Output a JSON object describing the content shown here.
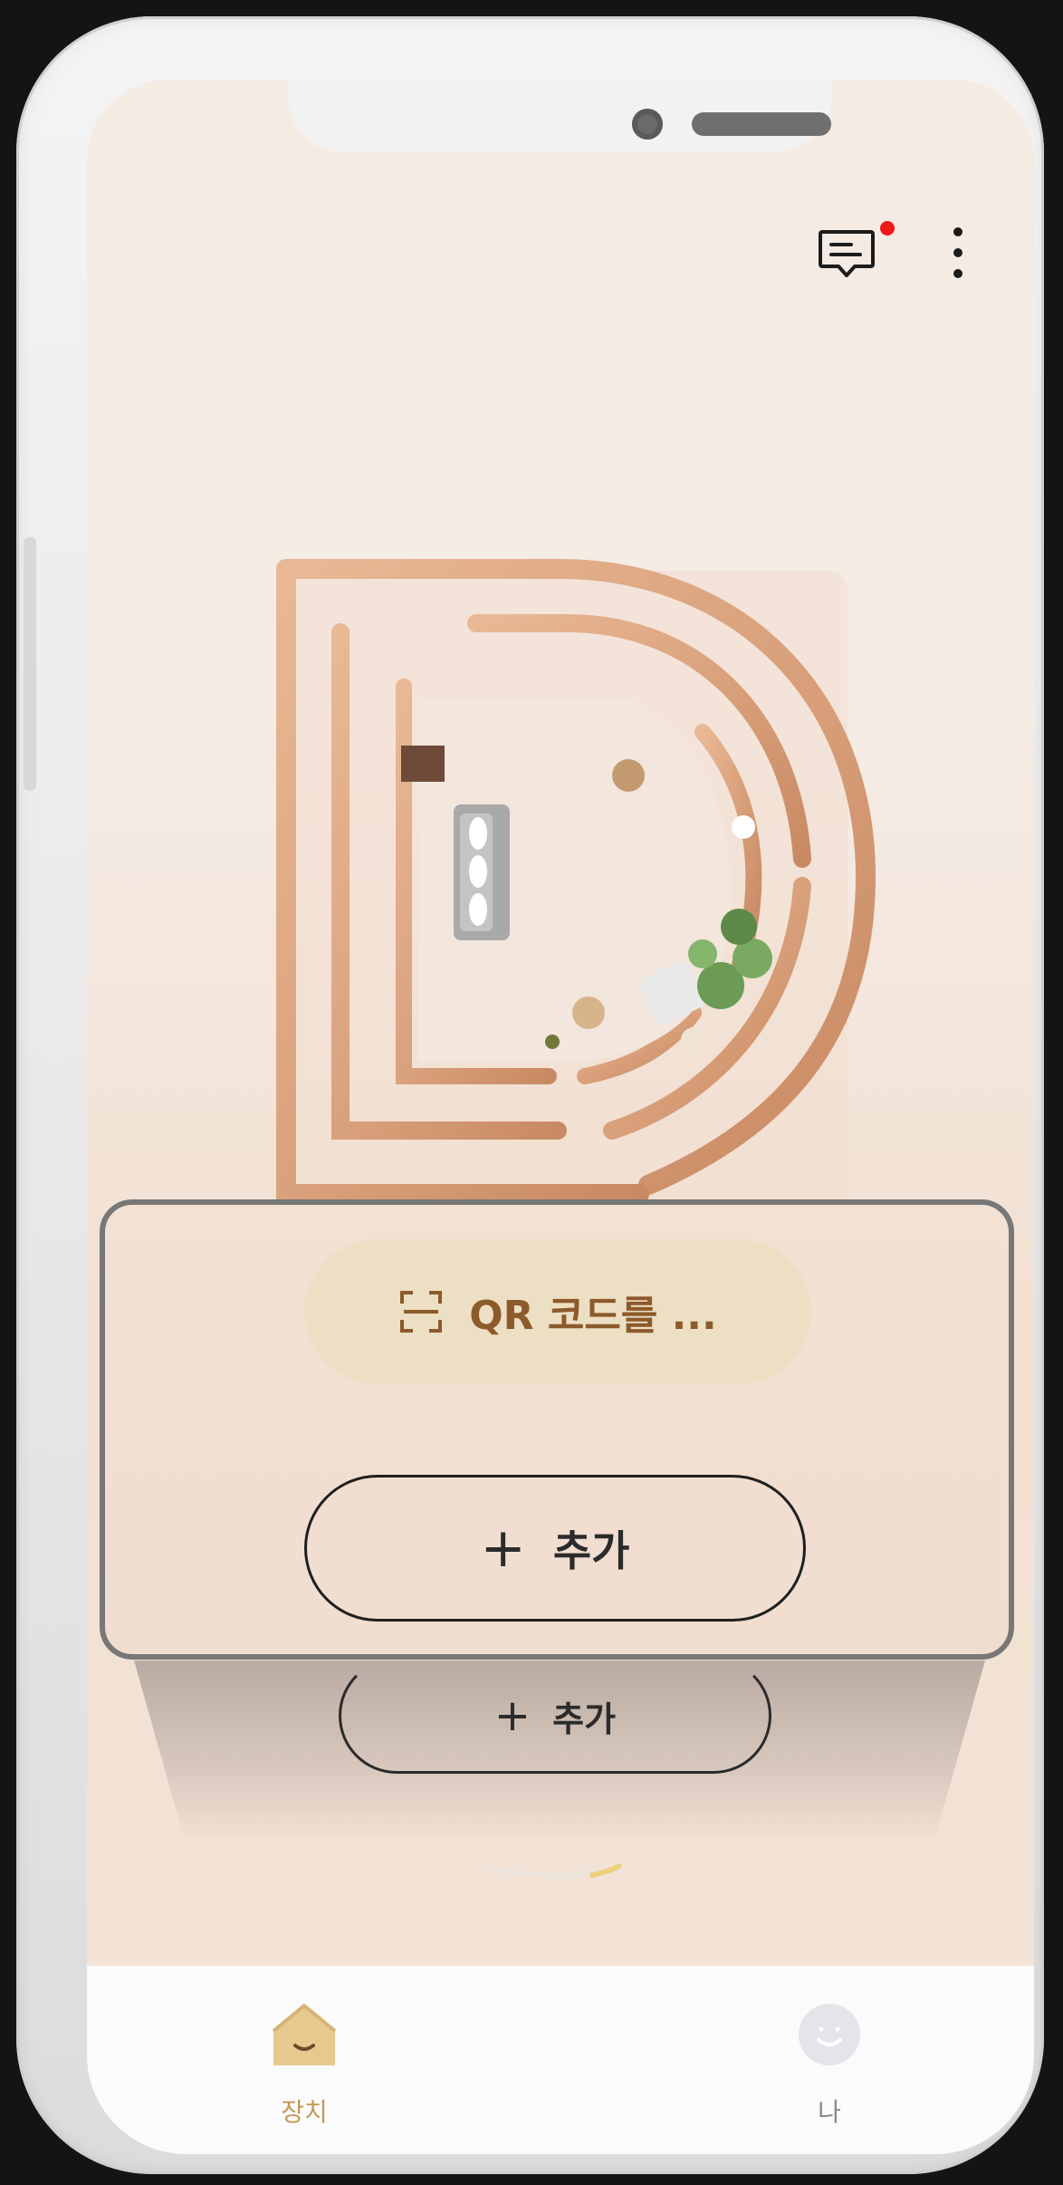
{
  "header": {
    "messages_icon": "message-icon",
    "more_icon": "more-vertical-icon",
    "notification_color": "#f01818"
  },
  "hero": {
    "art": "maze-letter-d-room-illustration"
  },
  "actions": {
    "scan_qr_label": "QR 코드를 ...",
    "scan_qr_icon": "qr-scan-icon",
    "add_label": "추가",
    "add_icon": "plus-icon",
    "add_label_secondary": "추가"
  },
  "tabbar": {
    "items": [
      {
        "label": "장치",
        "icon": "home-icon",
        "active": true
      },
      {
        "label": "나",
        "icon": "profile-icon",
        "active": false
      }
    ]
  },
  "colors": {
    "accent": "#c49a57",
    "qr_text": "#8c5a2b",
    "qr_background": "#ecdfc3"
  }
}
